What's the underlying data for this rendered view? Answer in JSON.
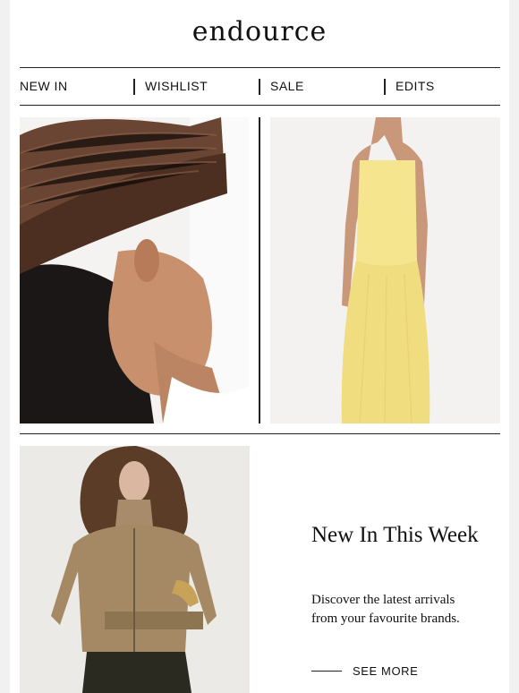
{
  "brand": {
    "logo_text": "endource"
  },
  "nav": {
    "items": [
      {
        "label": "NEW IN"
      },
      {
        "label": "WISHLIST"
      },
      {
        "label": "SALE"
      },
      {
        "label": "EDITS"
      }
    ]
  },
  "images": {
    "hat": {
      "icon": "woven-brown-hat-photo"
    },
    "dress": {
      "icon": "yellow-maxi-dress-photo"
    },
    "jacket": {
      "icon": "khaki-belted-jacket-photo"
    }
  },
  "promo": {
    "title": "New In This Week",
    "description": "Discover the latest arrivals from your favourite brands.",
    "cta_label": "SEE MORE"
  },
  "colors": {
    "background": "#f1f1f1",
    "card": "#ffffff",
    "text": "#111111"
  }
}
